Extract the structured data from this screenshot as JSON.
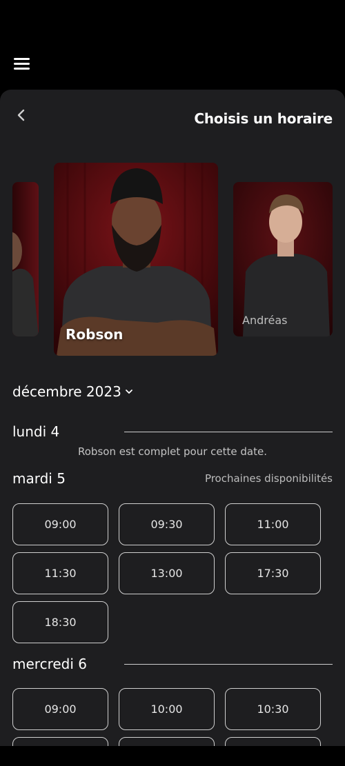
{
  "header": {
    "menu_icon": "hamburger-menu-icon"
  },
  "sheet": {
    "title": "Choisis un horaire",
    "back_icon": "chevron-left-icon"
  },
  "barbers": [
    {
      "name": "",
      "position": "left"
    },
    {
      "name": "Robson",
      "position": "center",
      "selected": true
    },
    {
      "name": "Andréas",
      "position": "right"
    }
  ],
  "month": {
    "label": "décembre 2023",
    "icon": "chevron-down-icon"
  },
  "days": [
    {
      "label": "lundi 4",
      "message": "Robson est complet pour cette date."
    },
    {
      "label": "mardi 5",
      "note": "Prochaines disponibilités",
      "slots": [
        "09:00",
        "09:30",
        "11:00",
        "11:30",
        "13:00",
        "17:30",
        "18:30"
      ]
    },
    {
      "label": "mercredi 6",
      "slots": [
        "09:00",
        "10:00",
        "10:30",
        "",
        "",
        ""
      ]
    }
  ],
  "colors": {
    "background": "#000000",
    "sheet": "#1e1e20",
    "portrait_bg": "#5a0f12"
  }
}
